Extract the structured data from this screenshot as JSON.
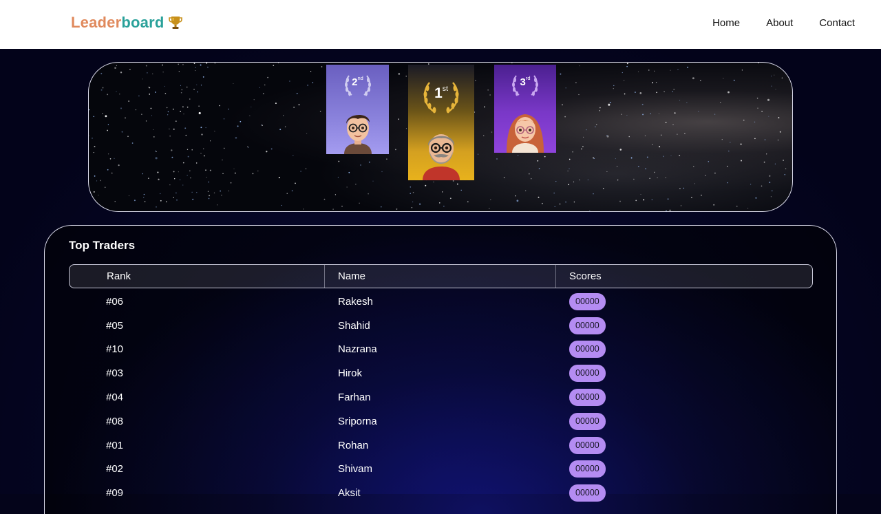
{
  "brand": {
    "part1": "Leader",
    "part2": "board",
    "icon": "trophy-icon"
  },
  "nav": {
    "home": "Home",
    "about": "About",
    "contact": "Contact"
  },
  "podium": [
    {
      "place": "2",
      "suffix": "nd",
      "color": "#8a82dc",
      "avatar": "boy-with-glasses"
    },
    {
      "place": "1",
      "suffix": "st",
      "color": "#e0a820",
      "avatar": "bearded-man-with-glasses"
    },
    {
      "place": "3",
      "suffix": "rd",
      "color": "#7a38c8",
      "avatar": "red-haired-girl-with-glasses"
    }
  ],
  "table": {
    "title": "Top Traders",
    "headers": {
      "rank": "Rank",
      "name": "Name",
      "score": "Scores"
    },
    "rows": [
      {
        "rank": "#06",
        "name": "Rakesh",
        "score": "00000"
      },
      {
        "rank": "#05",
        "name": "Shahid",
        "score": "00000"
      },
      {
        "rank": "#10",
        "name": "Nazrana",
        "score": "00000"
      },
      {
        "rank": "#03",
        "name": "Hirok",
        "score": "00000"
      },
      {
        "rank": "#04",
        "name": "Farhan",
        "score": "00000"
      },
      {
        "rank": "#08",
        "name": "Sriporna",
        "score": "00000"
      },
      {
        "rank": "#01",
        "name": "Rohan",
        "score": "00000"
      },
      {
        "rank": "#02",
        "name": "Shivam",
        "score": "00000"
      },
      {
        "rank": "#09",
        "name": "Aksit",
        "score": "00000"
      }
    ]
  },
  "colors": {
    "brand_orange": "#e0895c",
    "brand_teal": "#2aa19a",
    "score_pill": "#b48cf2"
  }
}
